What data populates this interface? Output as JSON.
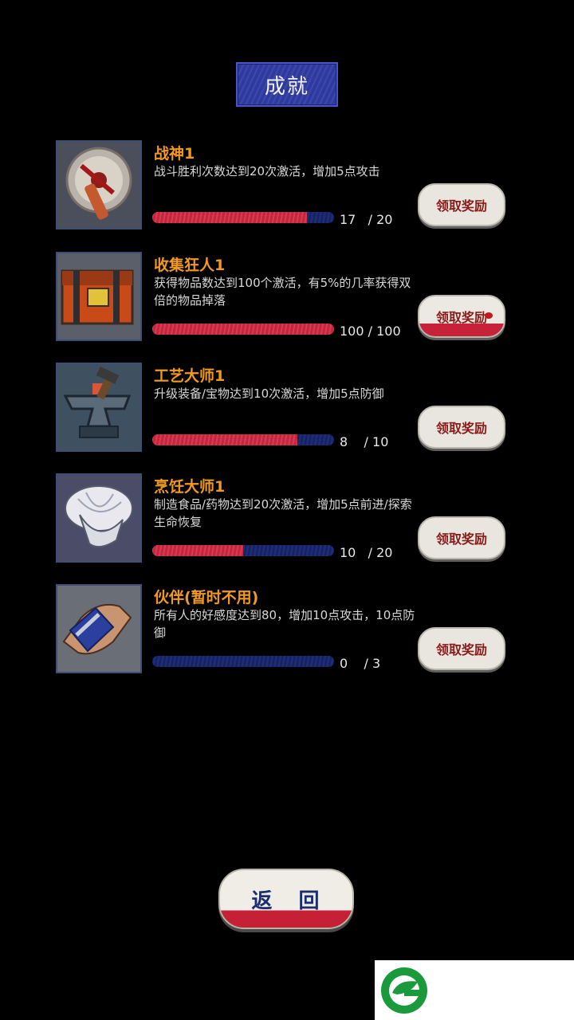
{
  "header": {
    "title": "成就"
  },
  "achievements": [
    {
      "name": "战神1",
      "desc": "战斗胜利次数达到20次激活，增加5点攻击",
      "current": "17",
      "total": "20",
      "progress": 0.85,
      "claim_label": "领取奖励",
      "claim_state": "disabled",
      "icon": "saw-blade-icon"
    },
    {
      "name": "收集狂人1",
      "desc": "获得物品数达到100个激活，有5%的几率获得双倍的物品掉落",
      "current": "100",
      "total": "100",
      "progress": 1.0,
      "claim_label": "领取奖励",
      "claim_state": "active",
      "icon": "treasure-chest-icon"
    },
    {
      "name": "工艺大师1",
      "desc": "升级装备/宝物达到10次激活，增加5点防御",
      "current": "8",
      "total": "10",
      "progress": 0.8,
      "claim_label": "领取奖励",
      "claim_state": "disabled",
      "icon": "anvil-icon"
    },
    {
      "name": "烹饪大师1",
      "desc": "制造食品/药物达到20次激活，增加5点前进/探索生命恢复",
      "current": "10",
      "total": "20",
      "progress": 0.5,
      "claim_label": "领取奖励",
      "claim_state": "disabled",
      "icon": "chef-hat-icon"
    },
    {
      "name": "伙伴(暂时不用)",
      "desc": "所有人的好感度达到80，增加10点攻击，10点防御",
      "current": "0",
      "total": "3",
      "progress": 0.0,
      "claim_label": "领取奖励",
      "claim_state": "disabled",
      "icon": "handshake-icon"
    }
  ],
  "footer": {
    "back_label": "返 回"
  },
  "colors": {
    "title_bg": "#2e3aa0",
    "name": "#f29a1e",
    "bar_fill": "#c9243b",
    "bar_empty": "#1d2c78",
    "logo": "#1a9a3a"
  },
  "watermark": {
    "icon": "leaf-logo-icon"
  }
}
